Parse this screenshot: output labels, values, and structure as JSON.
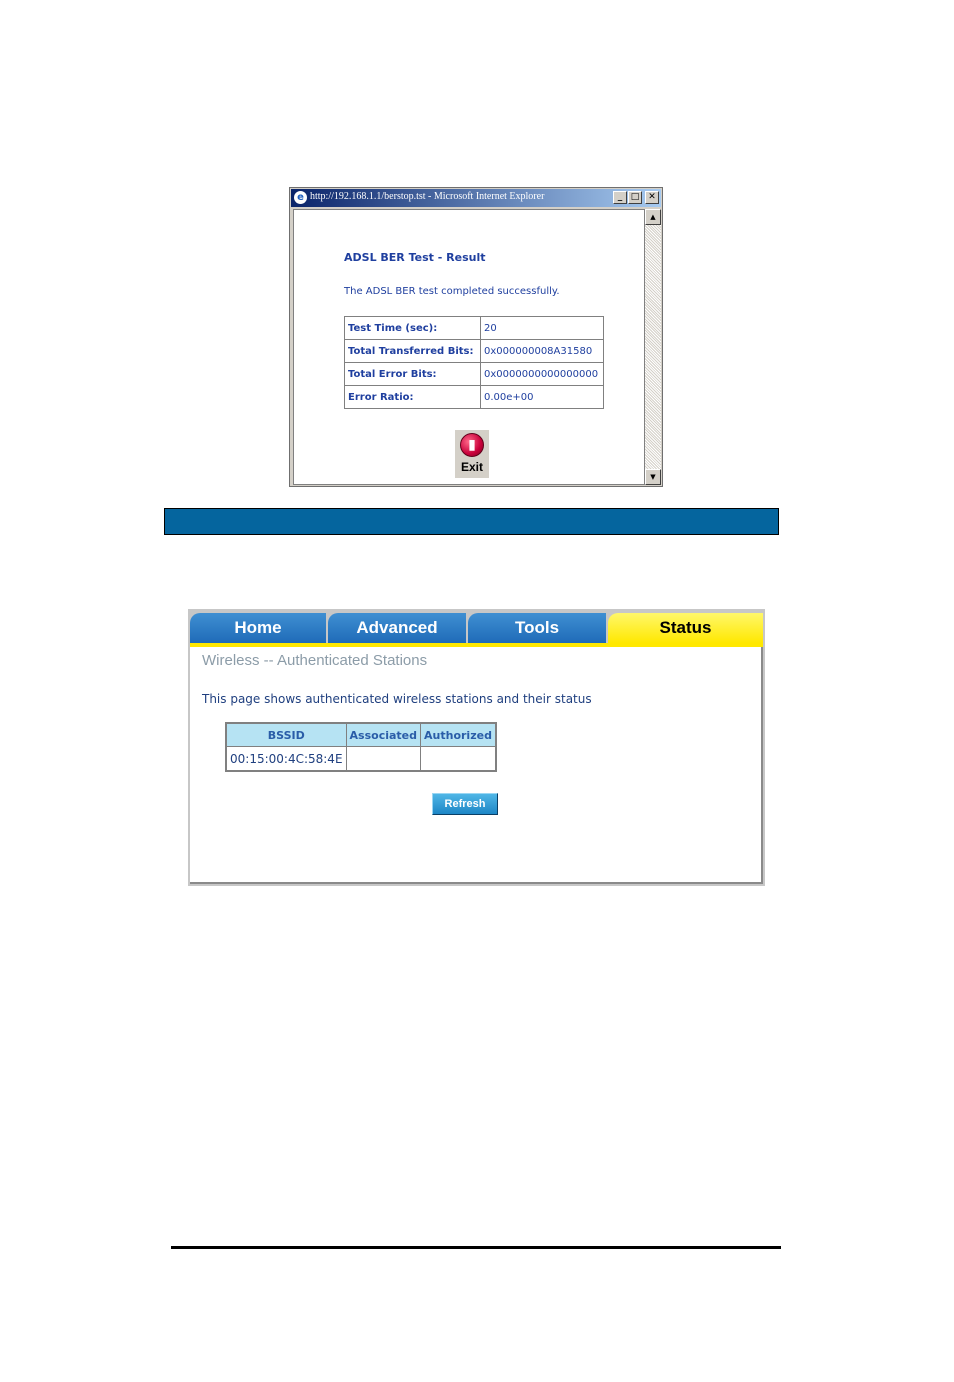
{
  "ie_window": {
    "title": "http://192.168.1.1/berstop.tst - Microsoft Internet Explorer",
    "minimize_glyph": "_",
    "maximize_glyph": "□",
    "close_glyph": "✕",
    "scroll_up_glyph": "▲",
    "scroll_down_glyph": "▼"
  },
  "ber_result": {
    "title": "ADSL BER Test - Result",
    "message": "The ADSL BER test completed successfully.",
    "rows": [
      {
        "label": "Test Time (sec):",
        "value": "20"
      },
      {
        "label": "Total Transferred Bits:",
        "value": "0x000000008A31580"
      },
      {
        "label": "Total Error Bits:",
        "value": "0x0000000000000000"
      },
      {
        "label": "Error Ratio:",
        "value": "0.00e+00"
      }
    ],
    "exit_label": "Exit",
    "exit_icon": "exit-door-icon"
  },
  "router": {
    "tabs": [
      {
        "label": "Home"
      },
      {
        "label": "Advanced"
      },
      {
        "label": "Tools"
      },
      {
        "label": "Status"
      }
    ],
    "active_tab": "Status",
    "page_title": "Wireless -- Authenticated Stations",
    "description": "This page shows authenticated wireless stations and their status",
    "table_headers": [
      "BSSID",
      "Associated",
      "Authorized"
    ],
    "stations": [
      {
        "bssid": "00:15:00:4C:58:4E",
        "associated": "",
        "authorized": ""
      }
    ],
    "refresh_label": "Refresh"
  },
  "colors": {
    "blue_bar": "#05659e",
    "tab_blue": "#1f6bb8",
    "tab_active": "#ffe800",
    "header_cell": "#b6e3f3"
  }
}
